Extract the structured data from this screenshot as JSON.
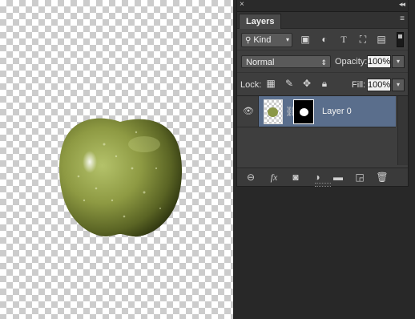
{
  "panel": {
    "close": "×",
    "collapse": "◂◂",
    "tab_label": "Layers",
    "menu_icon": "≡"
  },
  "filter": {
    "kind_label": "Kind",
    "icons": [
      "image-filter-icon",
      "adjustment-filter-icon",
      "type-filter-icon",
      "shape-filter-icon",
      "smart-object-filter-icon"
    ]
  },
  "blend": {
    "mode": "Normal",
    "opacity_label": "Opacity:",
    "opacity_value": "100%"
  },
  "lock": {
    "label": "Lock:",
    "fill_label": "Fill:",
    "fill_value": "100%"
  },
  "layers": [
    {
      "name": "Layer 0",
      "visible": true,
      "has_mask": true
    }
  ],
  "bottom_icons": [
    "link-layers-icon",
    "fx-icon",
    "add-mask-icon",
    "adjustment-layer-icon",
    "new-group-icon",
    "new-layer-icon",
    "trash-icon"
  ]
}
